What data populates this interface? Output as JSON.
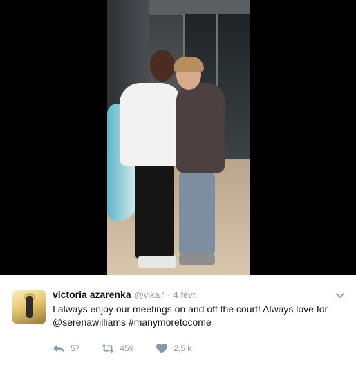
{
  "tweet": {
    "author_name": "victoria azarenka",
    "handle": "@vika7",
    "separator": "·",
    "timestamp": "4 févr.",
    "text_line1": "I always enjoy our meetings on and off the court! Always love for",
    "text_line2": "@serenawilliams #manymoretocome",
    "reply_count": "57",
    "retweet_count": "459",
    "like_count": "2,5 k"
  },
  "icons": {
    "more": "chevron-down-icon",
    "reply": "reply-icon",
    "retweet": "retweet-icon",
    "like": "heart-icon"
  },
  "colors": {
    "text": "#14171a",
    "muted": "#8899a6",
    "media_background": "#000000"
  }
}
